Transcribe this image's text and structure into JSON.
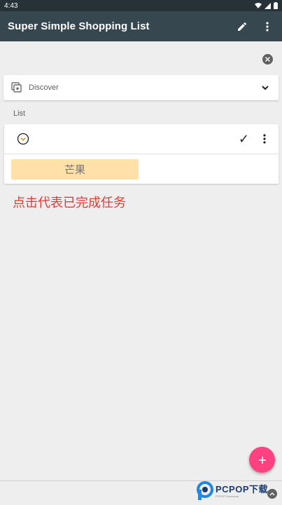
{
  "status_bar": {
    "time": "4:43"
  },
  "app_bar": {
    "title": "Super Simple Shopping List",
    "icons": [
      "edit-icon",
      "more-vert-icon"
    ]
  },
  "store_selector": {
    "label": "Discover",
    "icon": "store-icon"
  },
  "section": {
    "label": "List"
  },
  "list": {
    "check_symbol": "✓",
    "items": [
      {
        "label": "芒果"
      }
    ]
  },
  "annotation": {
    "text": "点击代表已完成任务"
  },
  "watermark": {
    "main": "PCPOP下载",
    "sub": "PCPOP Download"
  },
  "colors": {
    "status_bar": "#263238",
    "app_bar": "#37474f",
    "fab": "#ff4081",
    "item_chip": "#ffe0a8",
    "annotation": "#e53935",
    "expand_accent": "#e6a23c"
  }
}
